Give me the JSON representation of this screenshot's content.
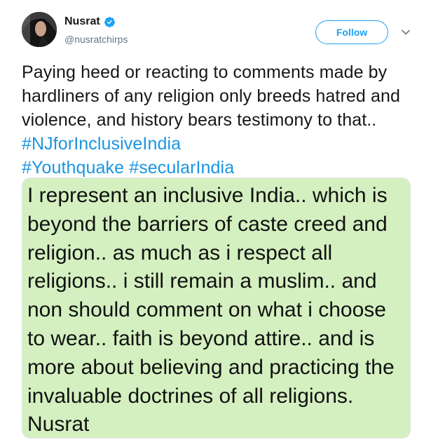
{
  "author": {
    "display_name": "Nusrat",
    "handle": "@nusratchirps",
    "verified": true,
    "avatar_icon": "avatar-photo"
  },
  "actions": {
    "follow_label": "Follow",
    "more_icon": "chevron-down-icon"
  },
  "tweet": {
    "text_part1": "Paying heed or reacting to comments made by hardliners of any religion only breeds hatred and violence, and history bears testimony to that.. ",
    "hashtags": [
      "#NJforInclusiveIndia",
      "#Youthquake",
      "#secularIndia"
    ]
  },
  "media": {
    "text": "I represent an inclusive India.. which is beyond the barriers of caste creed and religion.. as much as i respect all religions.. i still remain a muslim.. and non should comment on what i choose to wear.. faith is beyond attire.. and is more about believing and practicing the invaluable doctrines of all religions. Nusrat"
  },
  "colors": {
    "link": "#1b95e0",
    "follow_border": "#1da1f2",
    "verified": "#1da1f2",
    "media_background": "#d4f0c0"
  }
}
